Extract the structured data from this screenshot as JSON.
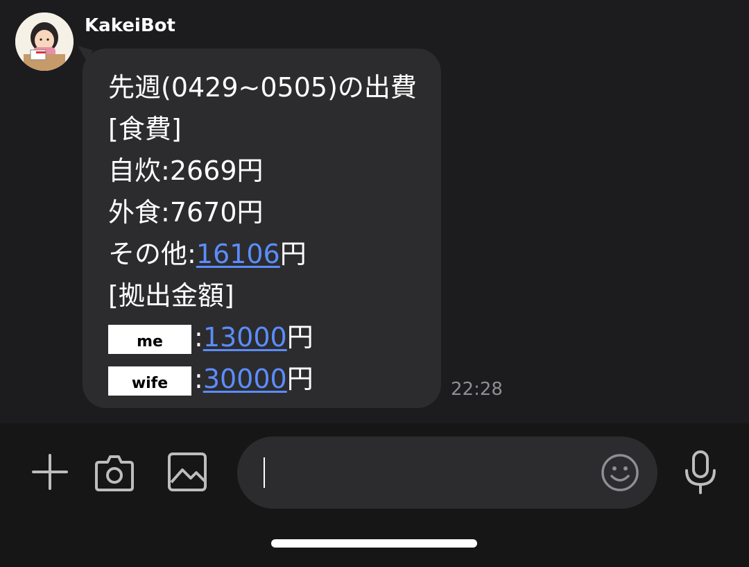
{
  "chat": {
    "sender_name": "KakeiBot",
    "message": {
      "title": "先週(0429~0505)の出費",
      "section_food": "[食費]",
      "self_cooking_label": "自炊:",
      "self_cooking_value": "2669円",
      "eating_out_label": "外食:",
      "eating_out_value": "7670円",
      "other_label": "その他:",
      "other_amount": "16106",
      "other_unit": "円",
      "section_contribution": "[拠出金額]",
      "me_label": "me",
      "me_sep": ":",
      "me_amount": "13000",
      "me_unit": "円",
      "wife_label": "wife",
      "wife_sep": ":",
      "wife_amount": "30000",
      "wife_unit": "円"
    },
    "timestamp": "22:28"
  },
  "input": {
    "placeholder": ""
  },
  "icons": {
    "add": "plus-icon",
    "camera": "camera-icon",
    "gallery": "image-icon",
    "emoji": "emoji-icon",
    "mic": "microphone-icon"
  },
  "colors": {
    "background": "#1c1c1e",
    "bubble": "#2c2c2e",
    "link": "#5b8dff",
    "timestamp": "#8e8e93"
  }
}
